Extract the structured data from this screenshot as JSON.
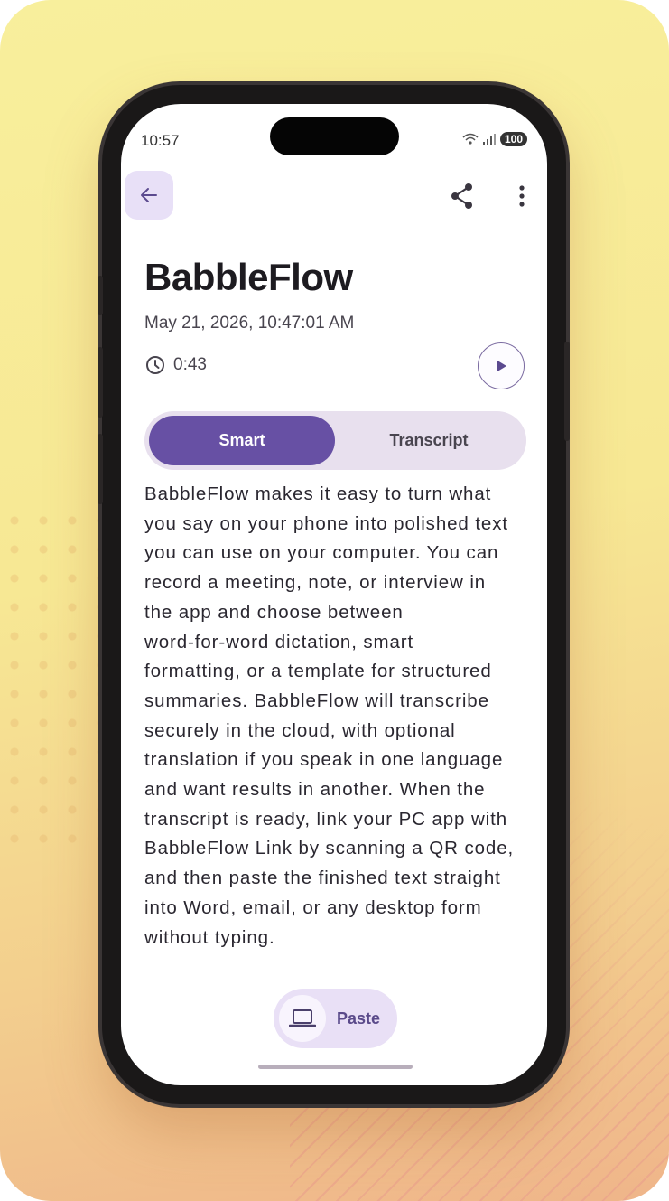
{
  "status_bar": {
    "time": "10:57",
    "battery": "100"
  },
  "header": {
    "back_icon": "arrow-left-icon",
    "share_icon": "share-icon",
    "more_icon": "more-vert-icon"
  },
  "recording": {
    "title": "BabbleFlow",
    "date": "May 21, 2026, 10:47:01 AM",
    "duration": "0:43"
  },
  "tabs": [
    {
      "label": "Smart",
      "selected": true
    },
    {
      "label": "Transcript",
      "selected": false
    }
  ],
  "body_lines": [
    "BabbleFlow makes it easy to turn what",
    "you say on your phone into polished text",
    "you can use on your computer. You can",
    "record a meeting, note, or interview in",
    "the app and choose between",
    "word-for-word dictation, smart",
    "formatting, or a template for structured",
    "summaries. BabbleFlow will transcribe",
    "securely in the cloud, with optional",
    "translation if you speak in one language",
    "and want results in another. When the",
    "transcript is ready, link your PC app with",
    "BabbleFlow Link by scanning a QR code,",
    "and then paste the finished text straight",
    "into Word, email, or any desktop form",
    "without typing."
  ],
  "paste_button": {
    "label": "Paste",
    "icon": "laptop-icon"
  },
  "colors": {
    "accent": "#6750a4",
    "tab_track": "#e8e0ee",
    "back_bg": "#e8e0f7"
  }
}
